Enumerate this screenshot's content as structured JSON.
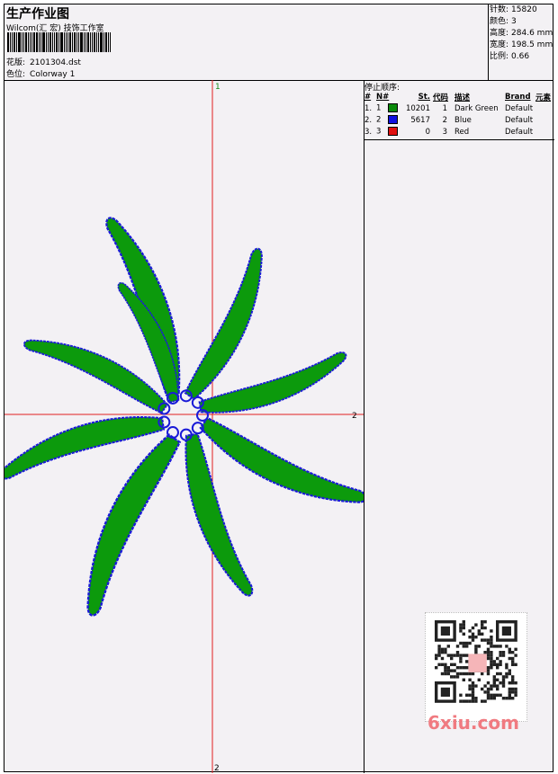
{
  "header": {
    "title": "生产作业图",
    "subtitle": "Wilcom(汇 宏) 技饰工作室",
    "design_label": "花版:",
    "design_value": "2101304.dst",
    "colorway_label": "色位:",
    "colorway_value": "Colorway 1"
  },
  "specs": {
    "stitches_label": "针数:",
    "stitches_value": "15820",
    "colors_label": "颜色:",
    "colors_value": "3",
    "height_label": "高度:",
    "height_value": "284.6 mm",
    "width_label": "宽度:",
    "width_value": "198.5 mm",
    "ratio_label": "比例:",
    "ratio_value": "0.66"
  },
  "stop_sequence": {
    "title": "停止顺序:",
    "headers": [
      "#",
      "N#",
      "St.",
      "代码",
      "描述",
      "Brand",
      "元素"
    ],
    "rows": [
      {
        "num": "1.",
        "n": "1",
        "color": "#0a8a0a",
        "st": "10201",
        "code": "1",
        "desc": "Dark Green",
        "brand": "Default"
      },
      {
        "num": "2.",
        "n": "2",
        "color": "#1010e0",
        "st": "5617",
        "code": "2",
        "desc": "Blue",
        "brand": "Default"
      },
      {
        "num": "3.",
        "n": "3",
        "color": "#e01010",
        "st": "0",
        "code": "3",
        "desc": "Red",
        "brand": "Default"
      }
    ]
  },
  "axes": {
    "top_label": "1",
    "right_label": "2",
    "bottom_label": "2"
  },
  "design_colors": {
    "fill": "#0c9a0c",
    "outline": "#1a1ad8",
    "guide": "#e02020"
  },
  "watermark": {
    "text": "6xiu.com",
    "color": "#f07a80"
  }
}
